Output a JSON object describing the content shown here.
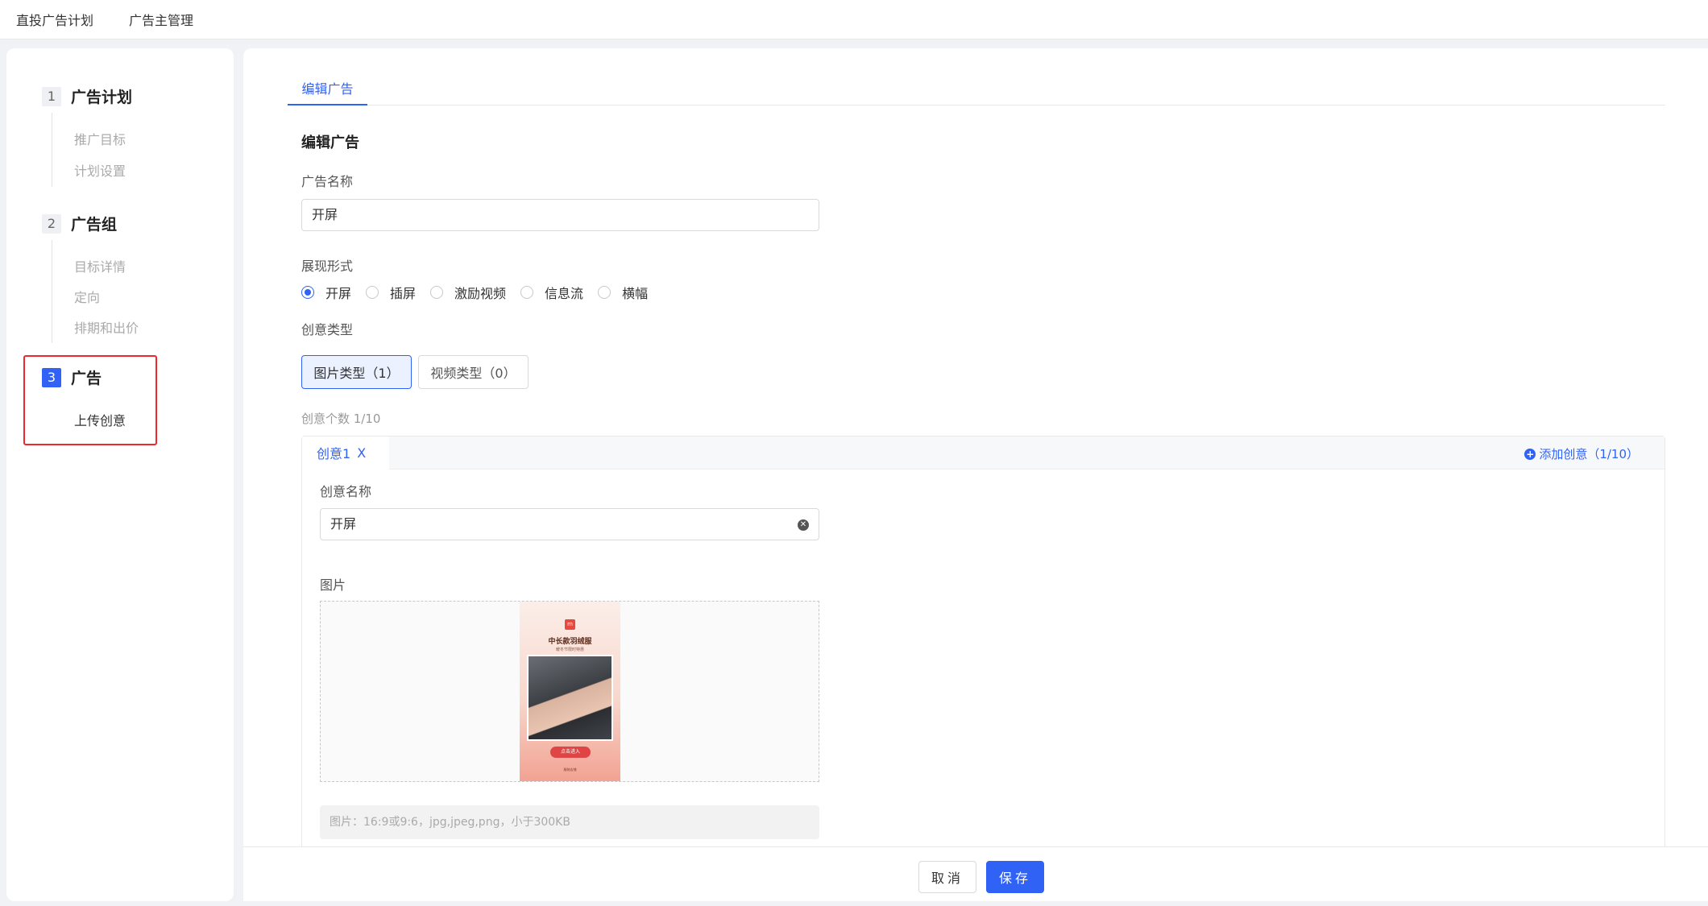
{
  "topnav": {
    "items": [
      "直投广告计划",
      "广告主管理"
    ]
  },
  "sidebar": {
    "steps": [
      {
        "num": "1",
        "title": "广告计划",
        "subs": [
          "推广目标",
          "计划设置"
        ]
      },
      {
        "num": "2",
        "title": "广告组",
        "subs": [
          "目标详情",
          "定向",
          "排期和出价"
        ]
      },
      {
        "num": "3",
        "title": "广告",
        "subs": [
          "上传创意"
        ]
      }
    ]
  },
  "main": {
    "tab": "编辑广告",
    "section_title": "编辑广告",
    "ad_name": {
      "label": "广告名称",
      "value": "开屏"
    },
    "display_format": {
      "label": "展现形式",
      "options": [
        "开屏",
        "插屏",
        "激励视频",
        "信息流",
        "横幅"
      ],
      "selected": "开屏"
    },
    "creative_type": {
      "label": "创意类型",
      "options": [
        "图片类型（1）",
        "视频类型（0）"
      ]
    },
    "creative_count": "创意个数 1/10",
    "creative": {
      "tab_label": "创意1",
      "close": "X",
      "add_label": "添加创意（1/10）",
      "name_label": "创意名称",
      "name_value": "开屏",
      "image_label": "图片",
      "image_hint": "图片：16:9或9:6，jpg,jpeg,png，小于300KB",
      "thumb": {
        "logo": "m",
        "title": "中长款羽绒服",
        "subtitle": "暖冬节限时特惠",
        "button": "点击进入",
        "footer": "服装店铺"
      }
    }
  },
  "footer": {
    "cancel": "取消",
    "save": "保存"
  },
  "colors": {
    "accent": "#2f62f5",
    "highlight": "#f0282d"
  }
}
